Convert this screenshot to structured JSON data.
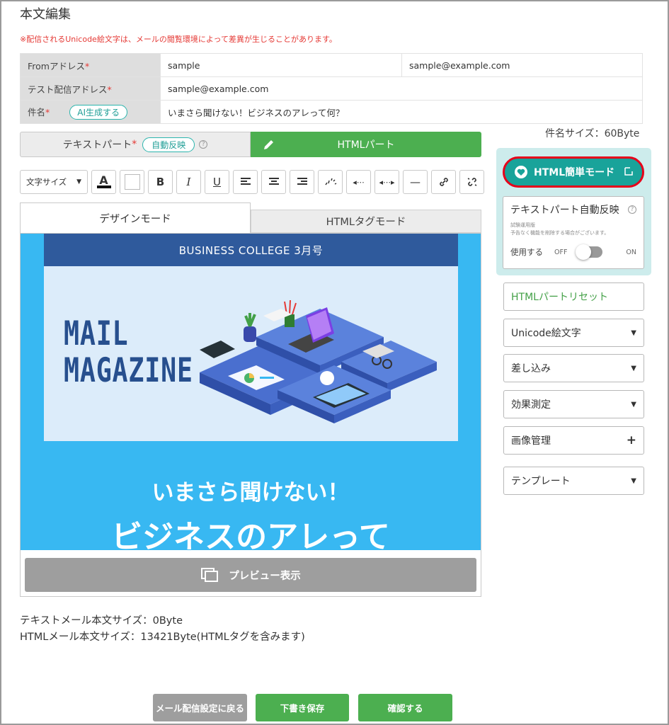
{
  "page": {
    "title": "本文編集",
    "notice": "※配信されるUnicode絵文字は、メールの閲覧環境によって差異が生じることがあります。"
  },
  "fields": {
    "from_label": "Fromアドレス",
    "from_name": "sample",
    "from_email": "sample@example.com",
    "test_label": "テスト配信アドレス",
    "test_email": "sample@example.com",
    "subject_label": "件名",
    "ai_button": "AI生成する",
    "subject_value": "いまさら聞けない！ビジネスのアレって何？",
    "required_mark": "*"
  },
  "subject_size": "件名サイズ：60Byte",
  "part_tabs": {
    "text_part": "テキストパート",
    "auto_reflect": "自動反映",
    "html_part": "HTMLパート"
  },
  "toolbar": {
    "font_size_select": "文字サイズ",
    "bold": "B",
    "italic": "I",
    "underline": "U",
    "text_color": "A",
    "dash": "—"
  },
  "mode_tabs": {
    "design": "デザインモード",
    "html_tag": "HTMLタグモード"
  },
  "newsletter": {
    "header": "BUSINESS COLLEGE 3月号",
    "hero_line1": "MAIL",
    "hero_line2": "MAGAZINE",
    "headline1": "いまさら聞けない！",
    "headline2": "ビジネスのアレって"
  },
  "preview_button": "プレビュー表示",
  "size_info": {
    "text_size": "テキストメール本文サイズ：0Byte",
    "html_size": "HTMLメール本文サイズ：13421Byte(HTMLタグを含みます)"
  },
  "side": {
    "easy_mode": "HTML簡単モード",
    "auto_title": "テキストパート自動反映",
    "auto_note1": "試験運用版",
    "auto_note2": "予告なく機能を削除する場合がございます。",
    "use_label": "使用する",
    "toggle_off": "OFF",
    "toggle_on": "ON",
    "toggle_state": false,
    "reset": "HTMLパートリセット",
    "emoji": "Unicode絵文字",
    "insert": "差し込み",
    "measure": "効果測定",
    "image": "画像管理",
    "template": "テンプレート"
  },
  "footer": {
    "back": "メール配信設定に戻る",
    "draft": "下書き保存",
    "confirm": "確認する"
  },
  "colors": {
    "green": "#4caf50",
    "teal": "#19a39a",
    "required": "#e53935",
    "canvas_bg": "#38b8f2",
    "newsletter_header": "#2f5a9c",
    "highlight_border": "#e6001a"
  }
}
